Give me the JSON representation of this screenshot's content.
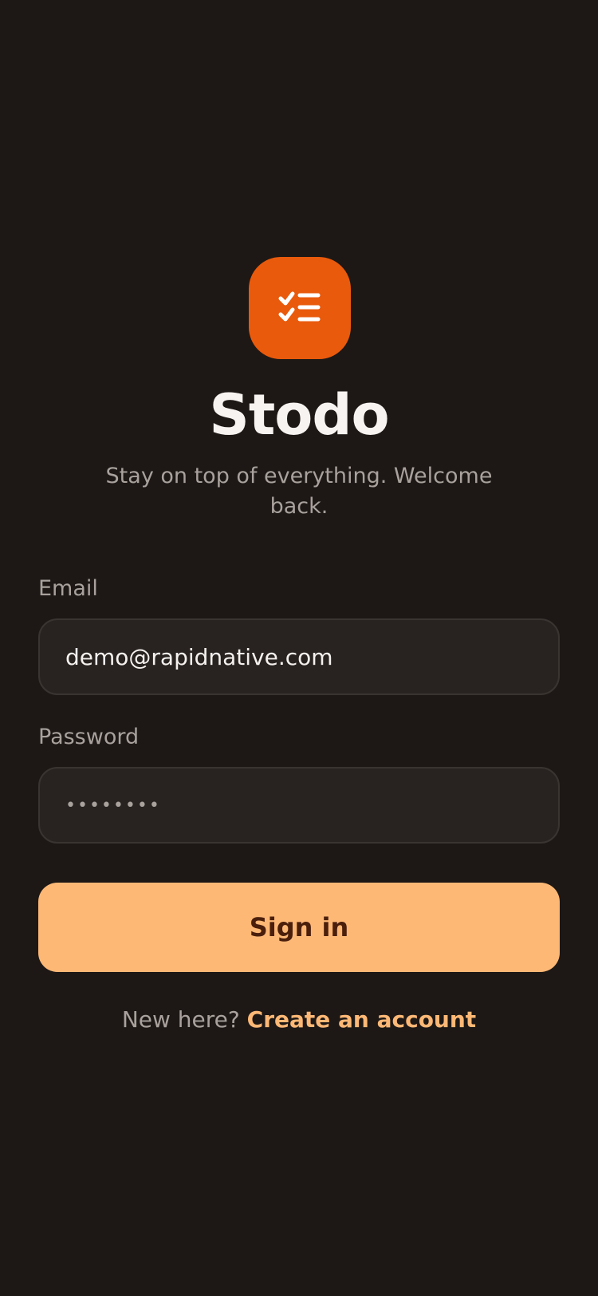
{
  "app": {
    "name": "Stodo",
    "tagline": "Stay on top of everything. Welcome back.",
    "logo_icon": "checklist-icon",
    "brand_color": "#e95a0c",
    "accent_color": "#fdb876"
  },
  "form": {
    "email": {
      "label": "Email",
      "value": "demo@rapidnative.com"
    },
    "password": {
      "label": "Password",
      "value": "••••••••"
    },
    "submit_label": "Sign in"
  },
  "footer": {
    "prompt": "New here?",
    "link_label": "Create an account"
  }
}
